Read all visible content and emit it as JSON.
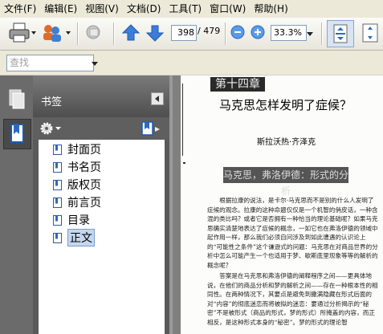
{
  "menu": [
    "文件(F)",
    "编辑(E)",
    "视图(V)",
    "文档(D)",
    "工具(T)",
    "窗口(W)",
    "帮助(H)"
  ],
  "toolbar": {
    "current_page": "398",
    "total_pages": "/ 479",
    "zoom": "33.3%"
  },
  "search": {
    "placeholder": "查找"
  },
  "panel": {
    "title": "书签",
    "bookmarks": [
      "封面页",
      "书名页",
      "版权页",
      "前言页",
      "目录",
      "正文"
    ],
    "selected_index": 5
  },
  "document": {
    "chapter": "第十四章",
    "title": "马克思怎样发明了症候？",
    "author": "斯拉沃热·齐泽克",
    "section": "马克思，弗洛伊德：形式的分析",
    "para1": "根据拉康的说法，是卡尔·马克思而不是别的什么人发明了症候的观念。拉康的这种命题仅仅是一个机智的俏皮话，一种含混的类比吗？或者它是否拥有一种恰当的理论基础呢？如果马克思确实清楚地表达了症候的概念，一如它也在弗洛伊德的领域中起作用一样，那么我们必须自问涉及到如此遭遇的认识论上的“可能性之条件”这个谦逊式的问题：马克思在对商品世界的分析中怎么可能产生一个也适用于梦、歇斯底里现象等等的解析的概念呢？",
    "para2": "答案是在马克思和弗洛伊德的阐释程序之间——更具体地说，在他们的商品分析和梦的解析之间——存在一种根本性的相同性。在两种情况下，其要点是避免到撒满隐藏在形式后面的对“内容”的彻底迷恋而将被拟的迷恋：要通过分析揭示的“秘密”不是被形式（商品的形式，梦的形式）所掩盖的内容，而正相反，是这种形式本身的“秘密”。梦的形式的理论智"
  }
}
